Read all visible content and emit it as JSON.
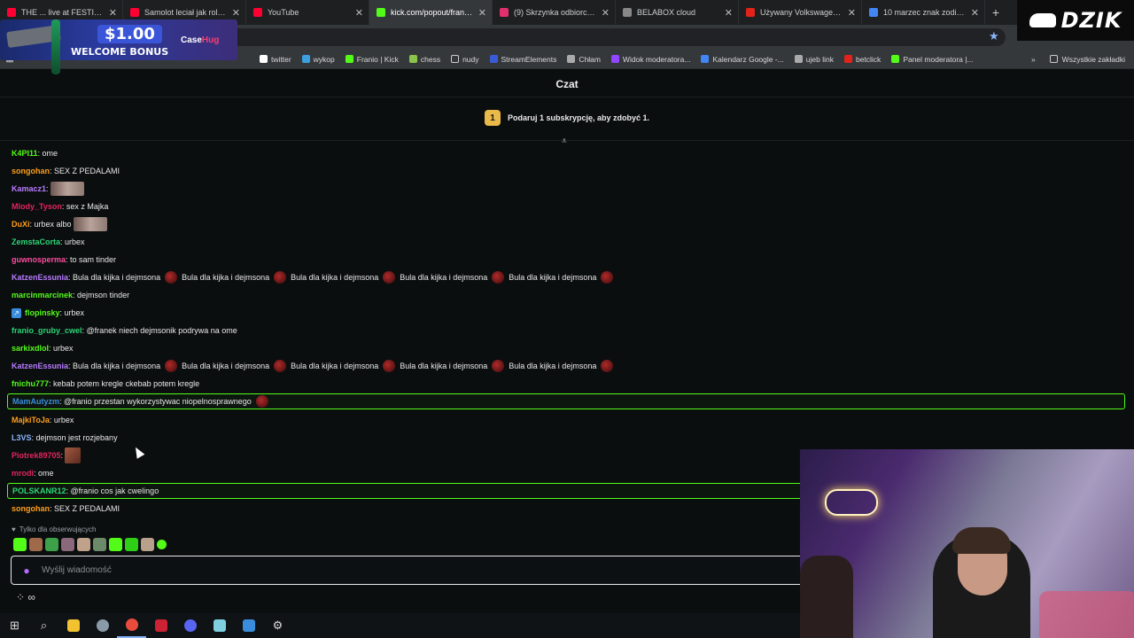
{
  "browser": {
    "tabs": [
      {
        "title": "THE ... live at FESTIVAL...",
        "favicon_color": "#ff0033"
      },
      {
        "title": "Samolot leciał jak rollerco...",
        "favicon_color": "#ff0033"
      },
      {
        "title": "YouTube",
        "favicon_color": "#ff0033"
      },
      {
        "title": "kick.com/popout/franio/c...",
        "favicon_color": "#53fc18"
      },
      {
        "title": "(9) Skrzynka odbiorcza • I...",
        "favicon_color": "#e1306c"
      },
      {
        "title": "BELABOX cloud",
        "favicon_color": "#888888"
      },
      {
        "title": "Używany Volkswagen Gol...",
        "favicon_color": "#e2231a"
      },
      {
        "title": "10 marzec znak zodiaku",
        "favicon_color": "#4285f4"
      }
    ],
    "bookmarks": [
      {
        "label": "twitter",
        "icon": "x-icon"
      },
      {
        "label": "wykop",
        "icon": "wykop-icon"
      },
      {
        "label": "Franio | Kick",
        "icon": "kick-icon"
      },
      {
        "label": "chess",
        "icon": "chess-icon"
      },
      {
        "label": "nudy",
        "icon": "folder-icon"
      },
      {
        "label": "StreamElements",
        "icon": "streamelements-icon"
      },
      {
        "label": "Chłam",
        "icon": "globe-icon"
      },
      {
        "label": "Widok moderatora...",
        "icon": "twitch-icon"
      },
      {
        "label": "Kalendarz Google -...",
        "icon": "calendar-icon"
      },
      {
        "label": "ujeb link",
        "icon": "globe-icon"
      },
      {
        "label": "betclick",
        "icon": "betclick-icon"
      },
      {
        "label": "Panel moderatora |...",
        "icon": "kick-icon"
      }
    ],
    "all_bookmarks": "Wszystkie zakładki"
  },
  "ad": {
    "amount": "$1.00",
    "bonus": "WELCOME BONUS",
    "brand_a": "Case",
    "brand_b": "Hug"
  },
  "logo": {
    "text": "DZIK"
  },
  "chat": {
    "header": "Czat",
    "sub_goal": {
      "count": "1",
      "text": "Podaruj 1 subskrypcję, aby zdobyć 1."
    },
    "messages": [
      {
        "user": "K4PI11",
        "color": "#53fc18",
        "text": ": ome"
      },
      {
        "user": "songohan",
        "color": "#ff9f1a",
        "text": ": SEX Z PEDALAMI"
      },
      {
        "user": "Kamacz1",
        "color": "#b77cff",
        "text": ":",
        "emote": "img"
      },
      {
        "user": "Mlody_Tyson",
        "color": "#e0245e",
        "text": ": sex z Majka"
      },
      {
        "user": "DuXi",
        "color": "#ff9f1a",
        "text": ": urbex albo",
        "emote": "img"
      },
      {
        "user": "ZemstaCorta",
        "color": "#2bd576",
        "text": ": urbex"
      },
      {
        "user": "guwnosperma",
        "color": "#ff4d9d",
        "text": ": to sam tinder"
      },
      {
        "user": "KatzenEssunia",
        "color": "#b77cff",
        "text": ": Bula dla kijka i dejmsona",
        "repeat": "Bula dla kijka i dejmsona"
      },
      {
        "user": "marcinmarcinek",
        "color": "#53fc18",
        "text": ": dejmson tinder"
      },
      {
        "user": "flopinsky",
        "color": "#53fc18",
        "text": ": urbex",
        "badge": true
      },
      {
        "user": "franio_gruby_cwel",
        "color": "#2bd576",
        "text": ": @franek niech dejmsonik podrywa na ome"
      },
      {
        "user": "sarkixdlol",
        "color": "#53fc18",
        "text": ": urbex"
      },
      {
        "user": "KatzenEssunia",
        "color": "#b77cff",
        "text": ": Bula dla kijka i dejmsona",
        "repeat": "Bula dla kijka i dejmsona"
      },
      {
        "user": "fnichu777",
        "color": "#53fc18",
        "text": ": kebab potem kregle ckebab potem kregle"
      },
      {
        "user": "MamAutyzm",
        "color": "#3a8ddc",
        "text": ": @franio przestan wykorzystywac niopelnosprawnego",
        "highlight": true
      },
      {
        "user": "MajkiToJa",
        "color": "#ff9f1a",
        "text": ": urbex"
      },
      {
        "user": "L3VS",
        "color": "#8ab4f8",
        "text": ": dejmson jest rozjebany"
      },
      {
        "user": "Piotrek89705",
        "color": "#e0245e",
        "text": ":",
        "emote": "small"
      },
      {
        "user": "mrodi",
        "color": "#e0245e",
        "text": ": ome"
      },
      {
        "user": "POLSKANR12",
        "color": "#2bd576",
        "text": ": @franio cos jak cwelingo",
        "highlight": true
      },
      {
        "user": "songohan",
        "color": "#ff9f1a",
        "text": ": SEX Z PEDALAMI"
      }
    ],
    "followers_only": "Tylko dla obserwujących",
    "input_placeholder": "Wyślij wiadomość",
    "tools_label": "∞"
  }
}
